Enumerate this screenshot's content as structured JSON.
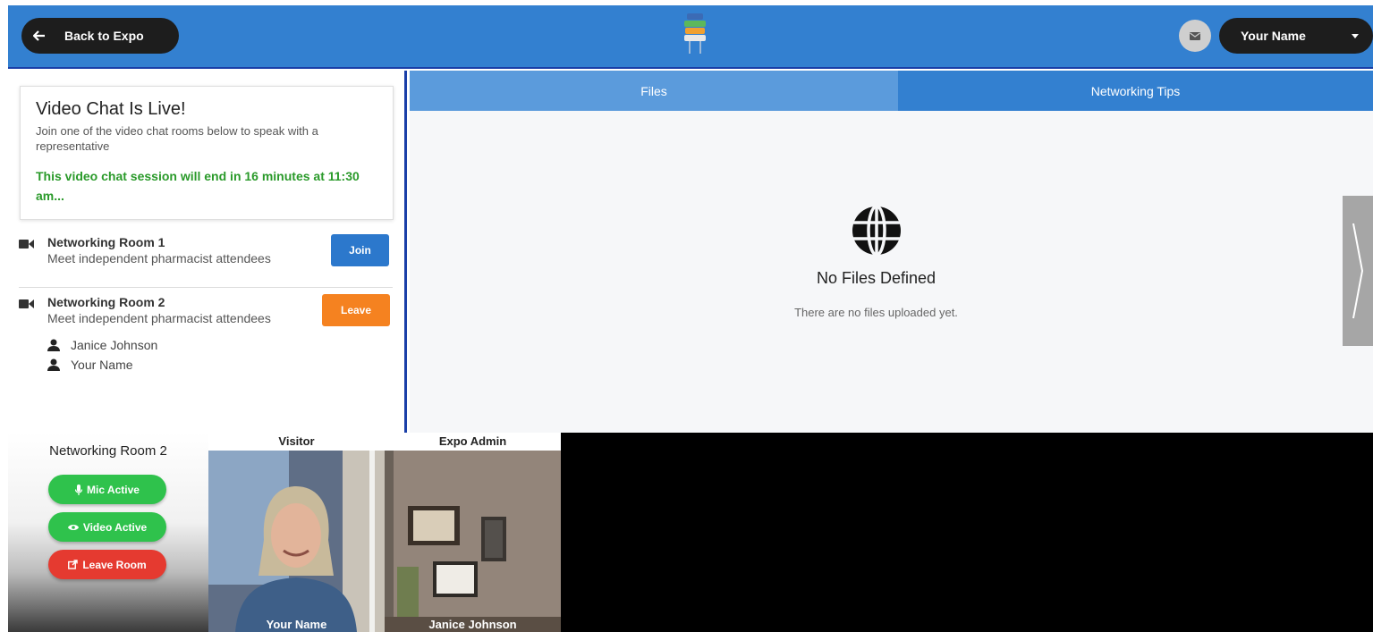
{
  "header": {
    "back_label": "Back to Expo",
    "user_name": "Your Name"
  },
  "live": {
    "title": "Video Chat Is Live!",
    "subtitle": "Join one of the video chat rooms below to speak with a representative",
    "timer": "This video chat session will end in 16 minutes at 11:30 am..."
  },
  "rooms": [
    {
      "name": "Networking Room 1",
      "description": "Meet independent pharmacist attendees",
      "action": "Join"
    },
    {
      "name": "Networking Room 2",
      "description": "Meet independent pharmacist attendees",
      "action": "Leave",
      "participants": [
        "Janice Johnson",
        "Your Name"
      ]
    }
  ],
  "tabs": [
    "Files",
    "Networking Tips"
  ],
  "files": {
    "empty_title": "No Files Defined",
    "empty_text": "There are no files uploaded yet."
  },
  "call": {
    "room_title": "Networking Room 2",
    "mic_label": "Mic Active",
    "video_label": "Video Active",
    "leave_label": "Leave Room",
    "tiles": [
      {
        "role": "Visitor",
        "name": "Your Name"
      },
      {
        "role": "Expo Admin",
        "name": "Janice Johnson"
      }
    ]
  },
  "colors": {
    "header_blue": "#3380d0",
    "join_blue": "#2c78cc",
    "leave_orange": "#f58220",
    "active_green": "#2fc24c",
    "leave_red": "#e53a30",
    "timer_green": "#2a9a2a"
  }
}
